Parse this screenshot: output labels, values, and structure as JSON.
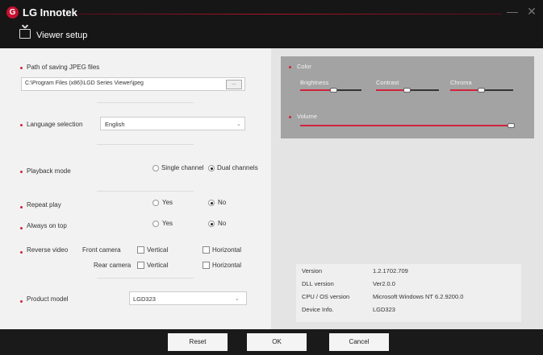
{
  "app": {
    "brand": "LG Innotek",
    "logo_glyph": "G",
    "title": "Viewer setup",
    "accent": "#d0233c",
    "minimize_glyph": "—",
    "close_glyph": "✕"
  },
  "left": {
    "path_label": "Path of saving JPEG files",
    "path_value": "C:\\Program Files (x86)\\LGD Series Viewer\\jpeg",
    "browse_label": "...",
    "language_label": "Language selection",
    "language_value": "English",
    "playback_label": "Playback mode",
    "playback_options": [
      "Single channel",
      "Dual channels"
    ],
    "playback_selected": "Dual channels",
    "repeat_label": "Repeat play",
    "repeat_options": [
      "Yes",
      "No"
    ],
    "repeat_selected": "No",
    "ontop_label": "Always on top",
    "ontop_options": [
      "Yes",
      "No"
    ],
    "ontop_selected": "No",
    "reverse_label": "Reverse video",
    "front_label": "Front camera",
    "rear_label": "Rear camera",
    "vertical_label": "Vertical",
    "horizontal_label": "Horizontal",
    "product_label": "Product model",
    "product_value": "LGD323"
  },
  "right": {
    "color_label": "Color",
    "brightness_label": "Brightness",
    "contrast_label": "Contrast",
    "chroma_label": "Chroma",
    "volume_label": "Volume",
    "brightness_level": 0.55,
    "contrast_level": 0.5,
    "chroma_level": 0.5,
    "volume_level": 1.0
  },
  "info": {
    "rows": [
      {
        "key": "Version",
        "value": "1.2.1702.709"
      },
      {
        "key": "DLL version",
        "value": "Ver2.0.0"
      },
      {
        "key": "CPU / OS version",
        "value": "Microsoft Windows NT 6.2.9200.0"
      },
      {
        "key": "Device Info.",
        "value": "LGD323"
      }
    ]
  },
  "buttons": {
    "reset": "Reset",
    "ok": "OK",
    "cancel": "Cancel"
  }
}
